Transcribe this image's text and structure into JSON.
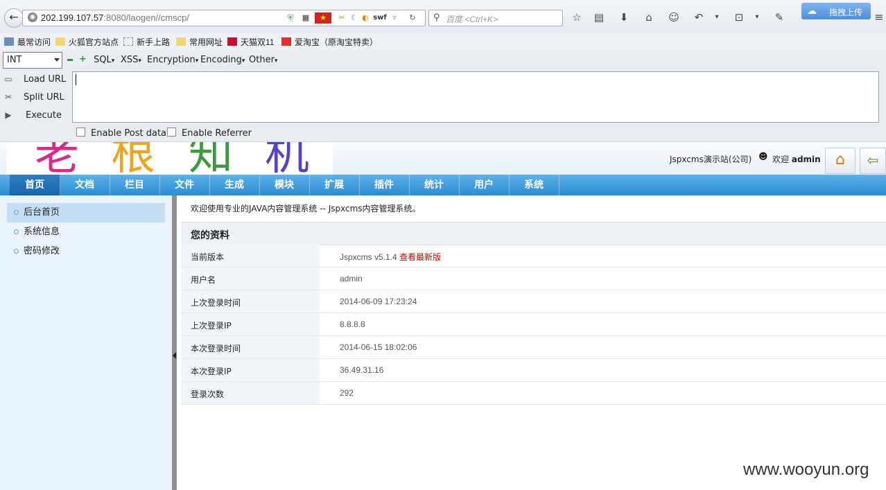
{
  "browser": {
    "url_host": "202.199.107.57",
    "url_rest": ":8080/laogen//cmscp/",
    "search_placeholder": "百度 <Ctrl+K>",
    "upload_button_label": "拖拽上传",
    "swf_label": "swf"
  },
  "bookmarks": [
    {
      "label": "最常访问",
      "icon": "gear-icon"
    },
    {
      "label": "火狐官方站点",
      "icon": "folder-icon"
    },
    {
      "label": "新手上路",
      "icon": "dashed-page-icon"
    },
    {
      "label": "常用网址",
      "icon": "folder-icon"
    },
    {
      "label": "天猫双11",
      "icon": "tmall-icon"
    },
    {
      "label": "爱淘宝（原淘宝特卖）",
      "icon": "taobao-icon"
    }
  ],
  "hackbar": {
    "select_value": "INT",
    "menus": [
      "SQL",
      "XSS",
      "Encryption",
      "Encoding",
      "Other"
    ],
    "load_url": "Load URL",
    "split_url": "Split URL",
    "execute": "Execute",
    "enable_post": "Enable Post data",
    "enable_referrer": "Enable Referrer"
  },
  "cms": {
    "logo_chars": [
      "老",
      "根",
      "知",
      "机"
    ],
    "site_name": "Jspxcms演示站(公司)",
    "welcome_prefix": "欢迎",
    "username": "admin",
    "nav": [
      "首页",
      "文档",
      "栏目",
      "文件",
      "生成",
      "模块",
      "扩展",
      "插件",
      "统计",
      "用户",
      "系统"
    ],
    "sidebar": [
      "后台首页",
      "系统信息",
      "密码修改"
    ],
    "intro": "欢迎使用专业的JAVA内容管理系统 -- Jspxcms内容管理系统。",
    "section_title": "您的资料",
    "rows": [
      {
        "key": "当前版本",
        "value": "Jspxcms v5.1.4",
        "link": "查看最新版"
      },
      {
        "key": "用户名",
        "value": "admin"
      },
      {
        "key": "上次登录时间",
        "value": "2014-06-09 17:23:24"
      },
      {
        "key": "上次登录IP",
        "value": "8.8.8.8"
      },
      {
        "key": "本次登录时间",
        "value": "2014-06-15 18:02:06"
      },
      {
        "key": "本次登录IP",
        "value": "36.49.31.16"
      },
      {
        "key": "登录次数",
        "value": "292"
      }
    ]
  },
  "watermark": "www.wooyun.org",
  "colors": {
    "nav_blue": "#2b8bd3",
    "link_red": "#cc0000",
    "sidebar_bg": "#eaf4fc"
  }
}
